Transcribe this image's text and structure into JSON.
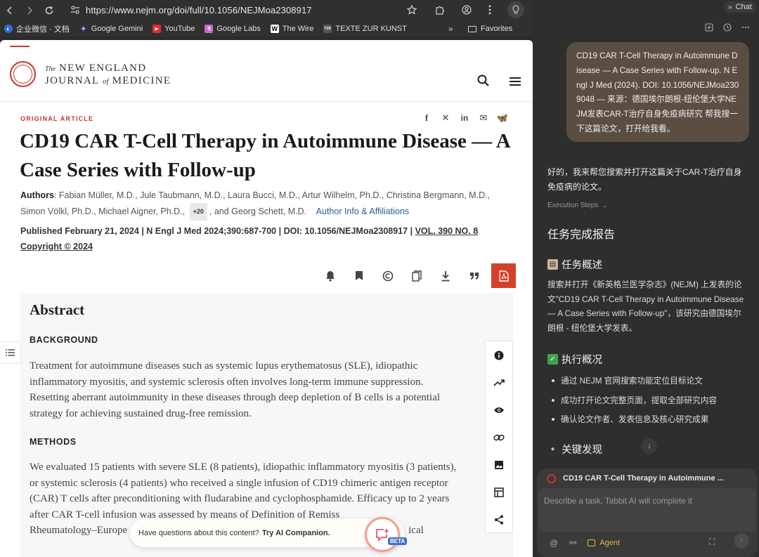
{
  "browser": {
    "url": "https://www.nejm.org/doi/full/10.1056/NEJMoa2308917",
    "bookmarks": [
      {
        "label": "企业微信 · 文档",
        "icon": "wecom-icon",
        "color": "#2b6fd6"
      },
      {
        "label": "Google Gemini",
        "icon": "gemini-icon",
        "color": "#6a8ff0"
      },
      {
        "label": "YouTube",
        "icon": "youtube-icon",
        "color": "#e02b2b"
      },
      {
        "label": "Google Labs",
        "icon": "google-labs-icon",
        "color": "#c86ac8"
      },
      {
        "label": "The Wire",
        "icon": "wire-icon",
        "color": "#ffffff"
      },
      {
        "label": "TEXTE ZUR KUNST",
        "icon": "tzk-icon",
        "color": "#555555"
      }
    ],
    "bookmarks_more": "»",
    "favorites": "Favorites"
  },
  "journal": {
    "logo_the": "The",
    "logo_line1": "NEW ENGLAND",
    "logo_journal": "JOURNAL",
    "logo_of": "of",
    "logo_medicine": "MEDICINE"
  },
  "article": {
    "label": "ORIGINAL ARTICLE",
    "title": "CD19 CAR T-Cell Therapy in Autoimmune Disease — A Case Series with Follow-up",
    "authors_label": "Authors",
    "authors_text": ": Fabian Müller, M.D., Jule Taubmann, M.D., Laura Bucci, M.D., Artur Wilhelm, Ph.D., Christina Bergmann, M.D., Simon Völkl, Ph.D., Michael Aigner, Ph.D.,",
    "more_authors": "+20",
    "authors_tail": ", and Georg Schett, M.D.",
    "author_info": "Author Info & Affiliations",
    "published": "Published February 21, 2024",
    "citation": "N Engl J Med 2024;390:687-700",
    "doi": "DOI: 10.1056/NEJMoa2308917",
    "volume": "VOL. 390 NO. 8",
    "copyright": "Copyright © 2024",
    "sep": "|"
  },
  "abstract": {
    "title": "Abstract",
    "background_head": "BACKGROUND",
    "background_text": "Treatment for autoimmune diseases such as systemic lupus erythematosus (SLE), idiopathic inflammatory myositis, and systemic sclerosis often involves long-term immune suppression. Resetting aberrant autoimmunity in these diseases through deep depletion of B cells is a potential strategy for achieving sustained drug-free remission.",
    "methods_head": "METHODS",
    "methods_text": "We evaluated 15 patients with severe SLE (8 patients), idiopathic inflammatory myositis (3 patients), or systemic sclerosis (4 patients) who received a single infusion of CD19 chimeric antigen receptor (CAR) T cells after preconditioning with fludarabine and cyclophosphamide. Efficacy up to 2 years after CAR T-cell infusion was assessed by means of Definition of Remiss",
    "methods_text_last": "Rheumatology–Europe",
    "methods_text_end": "ical"
  },
  "ai_companion": {
    "prompt": "Have questions about this content?",
    "cta": "Try AI Companion.",
    "beta": "BETA"
  },
  "panel": {
    "chat_label": "Chat",
    "user_message": "CD19 CAR T-Cell Therapy in Autoimmune Disease — A Case Series with Follow-up. N Engl J Med (2024). DOI: 10.1056/NEJMoa2309048 — 来源：德国埃尔朗根-纽伦堡大学NEJM发表CAR-T治疗自身免疫病研究 帮我搜一下这篇论文，打开给我看。",
    "reply": "好的，我来帮您搜索并打开这篇关于CAR-T治疗自身免疫病的论文。",
    "execution_steps": "Execution Steps",
    "report_title": "任务完成报告",
    "overview_title": "任务概述",
    "overview_text": "搜索并打开《新英格兰医学杂志》(NEJM) 上发表的论文\"CD19 CAR T-Cell Therapy in Autoimmune Disease — A Case Series with Follow-up\"，该研究由德国埃尔朗根 - 纽伦堡大学发表。",
    "execution_title": "执行概况",
    "execution_items": [
      "通过 NEJM 官网搜索功能定位目标论文",
      "成功打开论文完整页面，提取全部研究内容",
      "确认论文作者、发表信息及核心研究成果"
    ],
    "findings_title": "关键发现",
    "attachment": "CD19 CAR T-Cell Therapy in Autoimmune ...",
    "input_placeholder": "Describe a task, Tabbit AI will complete it",
    "agent_label": "Agent"
  }
}
